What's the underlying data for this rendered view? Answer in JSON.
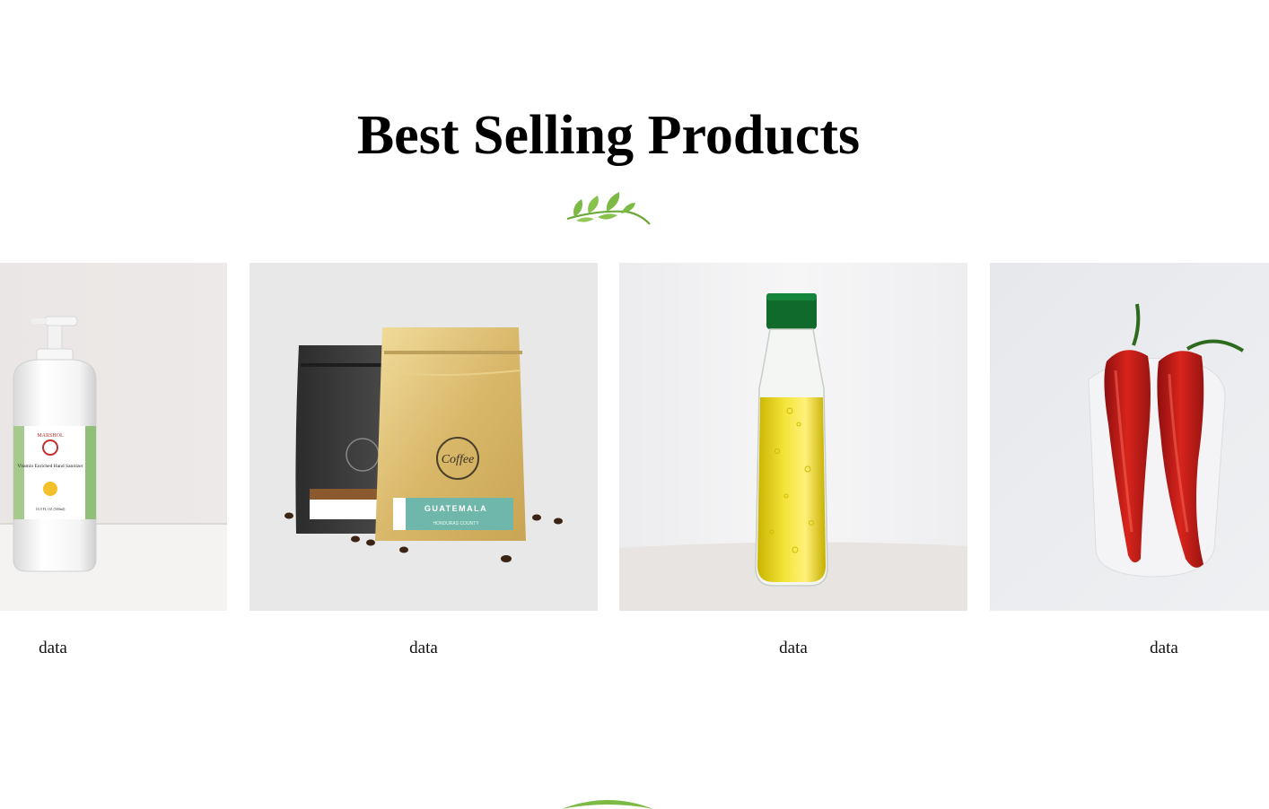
{
  "section": {
    "title": "Best Selling Products"
  },
  "products": [
    {
      "label": "data",
      "image": "hand-sanitizer-bottle",
      "text": {
        "brand": "MARSHOL",
        "name": "Vitamin Enriched Hand Sanitizer",
        "volume": "16.9 FL OZ (500ml)"
      }
    },
    {
      "label": "data",
      "image": "coffee-bags",
      "text": {
        "logo": "Coffee",
        "origin": "GUATEMALA",
        "region": "HONDURAS COUNTY"
      }
    },
    {
      "label": "data",
      "image": "oil-bottle"
    },
    {
      "label": "data",
      "image": "red-chili-peppers"
    }
  ],
  "colors": {
    "leaf_green": "#7cba45",
    "text": "#000000",
    "background": "#ffffff"
  }
}
